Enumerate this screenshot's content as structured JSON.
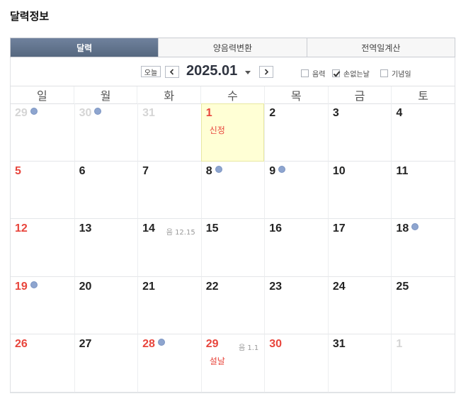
{
  "page": {
    "title": "달력정보"
  },
  "tabs": [
    {
      "label": "달력",
      "active": true
    },
    {
      "label": "양음력변환",
      "active": false
    },
    {
      "label": "전역일계산",
      "active": false
    }
  ],
  "toolbar": {
    "today_label": "오늘",
    "prev_icon": "chevron-left-icon",
    "next_icon": "chevron-right-icon",
    "month_label": "2025.01",
    "options": [
      {
        "label": "음력",
        "checked": false
      },
      {
        "label": "손없는날",
        "checked": true
      },
      {
        "label": "기념일",
        "checked": false
      }
    ]
  },
  "colors": {
    "accent_tab": "#5e7089",
    "holiday_red": "#e8453c",
    "today_bg": "#ffffd5",
    "dot_blue": "#8ea5cf"
  },
  "calendar": {
    "weekdays": [
      "일",
      "월",
      "화",
      "수",
      "목",
      "금",
      "토"
    ],
    "weeks": [
      [
        {
          "day": "29",
          "muted": true,
          "dot": true
        },
        {
          "day": "30",
          "muted": true,
          "dot": true
        },
        {
          "day": "31",
          "muted": true
        },
        {
          "day": "1",
          "red": true,
          "today": true,
          "holiday": "신정"
        },
        {
          "day": "2"
        },
        {
          "day": "3"
        },
        {
          "day": "4"
        }
      ],
      [
        {
          "day": "5",
          "red": true
        },
        {
          "day": "6"
        },
        {
          "day": "7"
        },
        {
          "day": "8",
          "dot": true
        },
        {
          "day": "9",
          "dot": true
        },
        {
          "day": "10"
        },
        {
          "day": "11"
        }
      ],
      [
        {
          "day": "12",
          "red": true
        },
        {
          "day": "13"
        },
        {
          "day": "14",
          "lunar": "음 12.15"
        },
        {
          "day": "15"
        },
        {
          "day": "16"
        },
        {
          "day": "17"
        },
        {
          "day": "18",
          "dot": true
        }
      ],
      [
        {
          "day": "19",
          "red": true,
          "dot": true
        },
        {
          "day": "20"
        },
        {
          "day": "21"
        },
        {
          "day": "22"
        },
        {
          "day": "23"
        },
        {
          "day": "24"
        },
        {
          "day": "25"
        }
      ],
      [
        {
          "day": "26",
          "red": true
        },
        {
          "day": "27"
        },
        {
          "day": "28",
          "red": true,
          "dot": true
        },
        {
          "day": "29",
          "red": true,
          "holiday": "설날",
          "lunar": "음 1.1"
        },
        {
          "day": "30",
          "red": true
        },
        {
          "day": "31"
        },
        {
          "day": "1",
          "muted": true
        }
      ]
    ]
  }
}
